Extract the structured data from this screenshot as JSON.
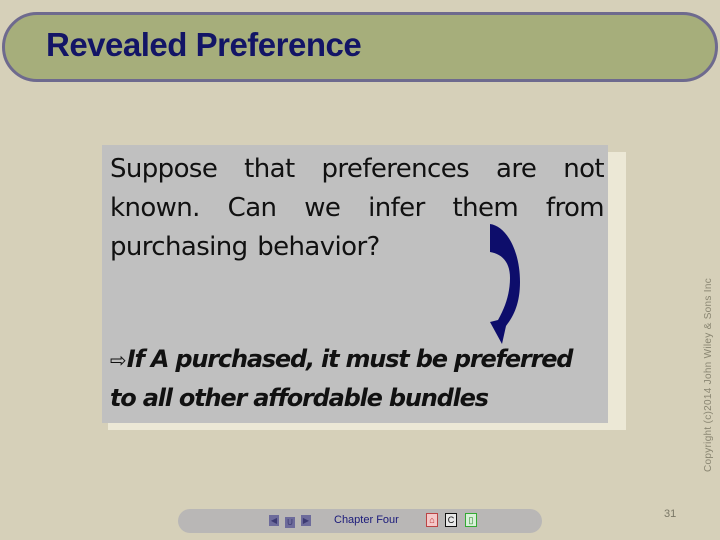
{
  "slide": {
    "title": "Revealed Preference",
    "body_text": "Suppose that preferences are not known.  Can we infer them from purchasing behavior?",
    "bullet": {
      "marker": "⇨",
      "text": "If A purchased, it must be preferred to all other affordable bundles"
    },
    "copyright": "Copyright (c)2014 John Wiley & Sons Inc",
    "page_number": "31"
  },
  "footer": {
    "chapter_label": "Chapter Four",
    "nav": {
      "prev": "◀",
      "return": "U",
      "next": "▶"
    },
    "icons": {
      "home": "⌂",
      "contents": "C",
      "exit": "▯"
    }
  },
  "colors": {
    "background": "#d6d0b9",
    "title_bar": "#a6ae7b",
    "title_border": "#6e6a8e",
    "title_text": "#131566",
    "panel": "#c0c0c0",
    "arrow": "#0d0d6b"
  }
}
